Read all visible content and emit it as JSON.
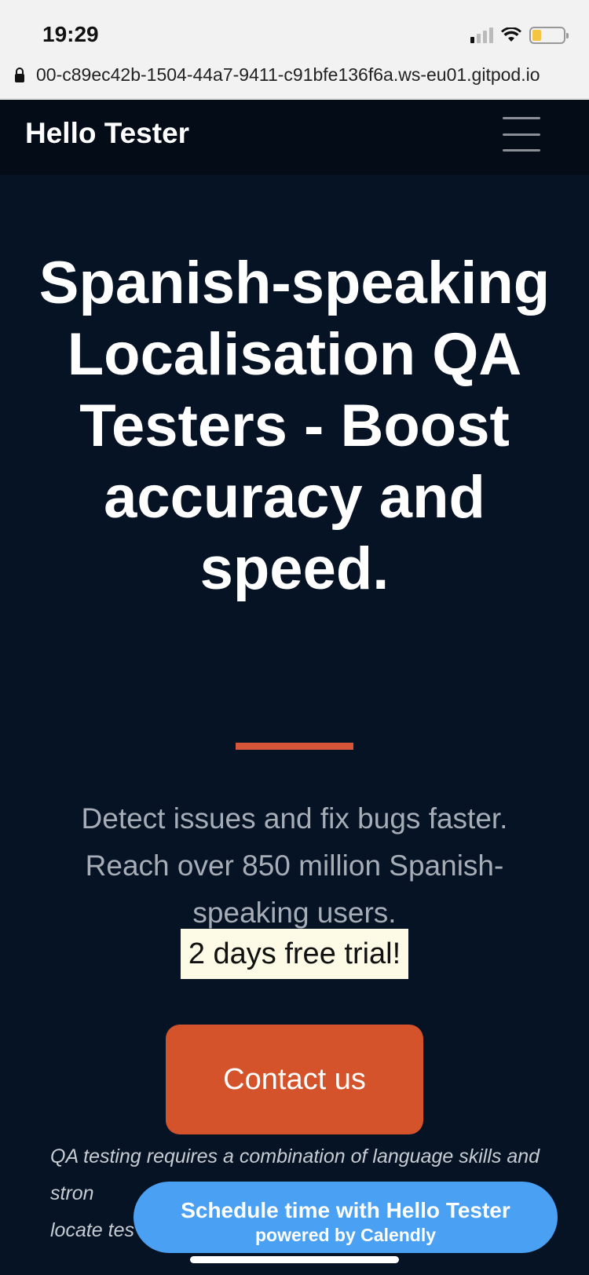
{
  "status_bar": {
    "time": "19:29",
    "signal_icon": "cellular-signal-icon",
    "wifi_icon": "wifi-icon",
    "battery_icon": "battery-icon",
    "battery_level": 0.3
  },
  "browser": {
    "lock_icon": "lock-icon",
    "url": "00-c89ec42b-1504-44a7-9411-c91bfe136f6a.ws-eu01.gitpod.io"
  },
  "navbar": {
    "brand": "Hello Tester",
    "menu_icon": "hamburger-menu-icon"
  },
  "hero": {
    "headline": "Spanish-speaking Localisation QA Testers - Boost accuracy and speed.",
    "subtext": "Detect issues and fix bugs faster. Reach over 850 million Spanish-speaking users.",
    "trial_badge": "2 days free trial!",
    "cta_label": "Contact us",
    "body_copy": "QA testing requires a combination of language skills and stron",
    "body_copy_line3": "locate tes"
  },
  "calendly": {
    "title": "Schedule time with Hello Tester",
    "subtitle": "powered by Calendly"
  },
  "colors": {
    "navbar_bg": "#030c17",
    "hero_bg": "#061325",
    "accent": "#d4532a",
    "calendly_blue": "#4aa1f3",
    "trial_bg": "#fdfbe6"
  }
}
